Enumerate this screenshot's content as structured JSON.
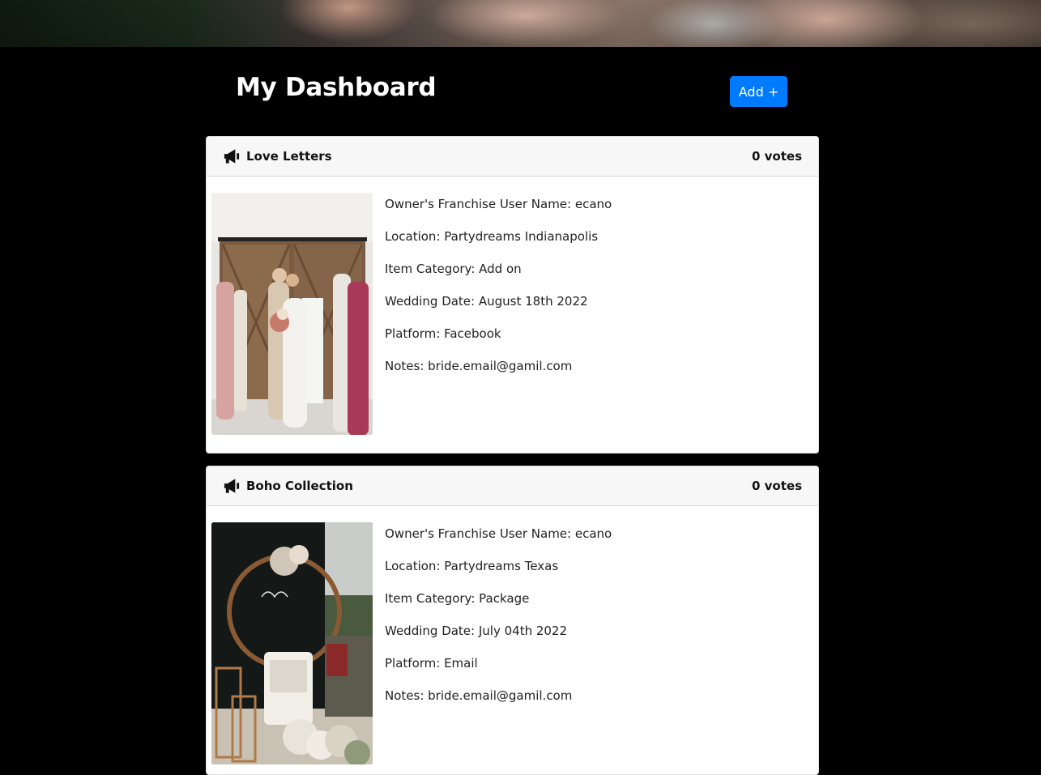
{
  "dashboard": {
    "title": "My Dashboard",
    "add_label": "Add +"
  },
  "cards": [
    {
      "title": "Love Letters",
      "votes": "0 votes",
      "details": [
        "Owner's Franchise User Name: ecano",
        "Location: Partydreams Indianapolis",
        "Item Category: Add on",
        "Wedding Date: August 18th 2022",
        "Platform: Facebook",
        "Notes: bride.email@gamil.com"
      ]
    },
    {
      "title": "Boho Collection",
      "votes": "0 votes",
      "details": [
        "Owner's Franchise User Name: ecano",
        "Location: Partydreams Texas",
        "Item Category: Package",
        "Wedding Date: July 04th 2022",
        "Platform: Email",
        "Notes: bride.email@gamil.com"
      ]
    }
  ],
  "icons": {
    "card_icon": "megaphone-icon"
  },
  "colors": {
    "accent": "#007bff",
    "background": "#000000",
    "card_header": "#f7f7f7"
  }
}
